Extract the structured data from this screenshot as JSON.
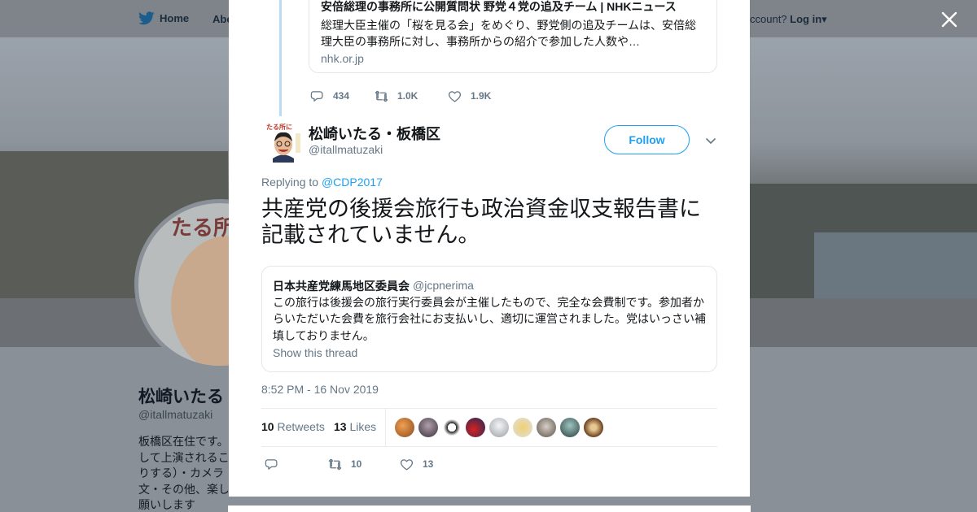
{
  "colors": {
    "accent": "#1da1f2",
    "muted": "#657786",
    "text": "#14171a",
    "thread_line": "#b8dcf7"
  },
  "nav": {
    "home_label": "Home",
    "about_label": "Abo",
    "account_prompt": "ccount?",
    "login_label": "Log in"
  },
  "profile": {
    "avatar_sign": "たる所",
    "name": "松崎いたる",
    "handle": "@itallmatuzaki",
    "bio": "板橋区在住です。\nして上演されるこ\nりする）・カメラ\n文・その他、楽し\n願いします"
  },
  "previous_tweet": {
    "link_card": {
      "title": "安倍総理の事務所に公開質問状 野党４党の追及チーム | NHKニュース",
      "description": "総理大臣主催の「桜を見る会」をめぐり、野党側の追及チームは、安倍総理大臣の事務所に対し、事務所からの紹介で参加した人数や…",
      "domain": "nhk.or.jp"
    },
    "replies": "434",
    "retweets": "1.0K",
    "likes": "1.9K"
  },
  "tweet": {
    "author_name": "松崎いたる・板橋区",
    "author_handle": "@itallmatuzaki",
    "follow_label": "Follow",
    "replying_to_label": "Replying to",
    "replying_to_handle": "@CDP2017",
    "text": "共産党の後援会旅行も政治資金収支報告書に記載されていません。",
    "quote": {
      "name": "日本共産党練馬地区委員会",
      "handle": "@jcpnerima",
      "text": "この旅行は後援会の旅行実行委員会が主催したもので、完全な会費制です。参加者からいただいた会費を旅行会社にお支払いし、適切に運営されました。党はいっさい補填しておりません。",
      "show_thread": "Show this thread"
    },
    "timestamp": "8:52 PM - 16 Nov 2019",
    "retweet_count": "10",
    "retweets_label": "Retweets",
    "like_count": "13",
    "likes_label": "Likes",
    "action_retweets": "10",
    "action_likes": "13"
  },
  "icons": [
    "twitter-bird-icon",
    "caret-down-icon",
    "close-icon",
    "reply-icon",
    "retweet-icon",
    "heart-icon",
    "chevron-down-icon"
  ]
}
